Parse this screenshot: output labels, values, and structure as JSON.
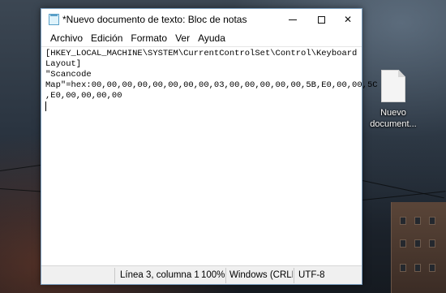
{
  "window": {
    "title": "*Nuevo documento de texto: Bloc de notas",
    "app_icon": "notepad-icon",
    "controls": {
      "minimize": "minimize-icon",
      "maximize": "maximize-icon",
      "close_label": "✕"
    }
  },
  "menubar": {
    "items": [
      {
        "label": "Archivo"
      },
      {
        "label": "Edición"
      },
      {
        "label": "Formato"
      },
      {
        "label": "Ver"
      },
      {
        "label": "Ayuda"
      }
    ]
  },
  "editor": {
    "lines": [
      "[HKEY_LOCAL_MACHINE\\SYSTEM\\CurrentControlSet\\Control\\Keyboard",
      "Layout]",
      "\"Scancode",
      "Map\"=hex:00,00,00,00,00,00,00,00,03,00,00,00,00,00,5B,E0,00,00,5C",
      ",E0,00,00,00,00"
    ]
  },
  "statusbar": {
    "position": "Línea 3, columna 1",
    "zoom": "100%",
    "line_ending": "Windows (CRLF)",
    "encoding": "UTF-8"
  },
  "desktop": {
    "icon": {
      "label": "Nuevo documento de texto",
      "label_display": "Nuevo\ndocument...",
      "icon": "text-document-icon"
    }
  },
  "colors": {
    "window_border": "#7a9ebf",
    "statusbar_bg": "#f0f0f0"
  }
}
